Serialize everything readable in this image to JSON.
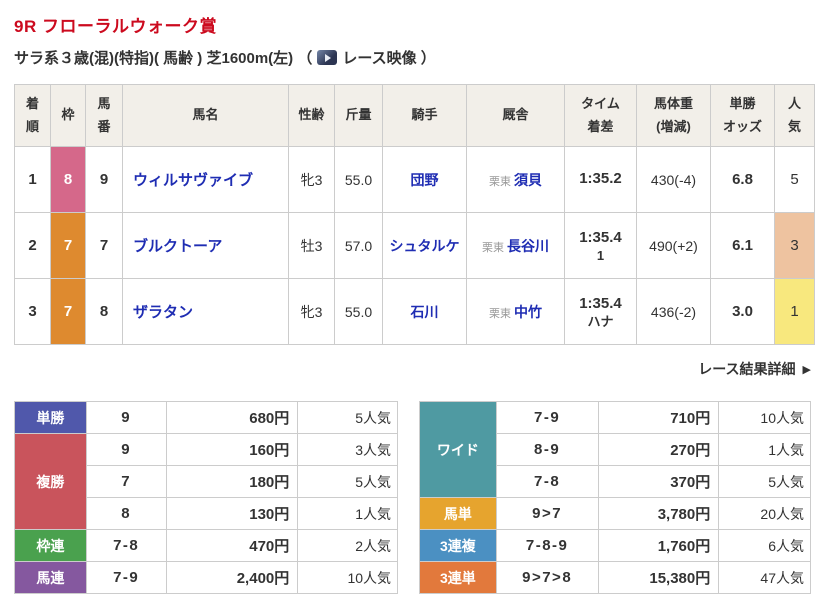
{
  "header": {
    "title": "9R フローラルウォーク賞",
    "title_color": "#cc0a1e",
    "conditions": "サラ系３歳(混)(特指)( 馬齢 ) 芝1600m(左)",
    "video_paren_open": "（",
    "video_label": "レース映像",
    "video_paren_close": "）"
  },
  "results": {
    "headers": [
      "着\n順",
      "枠",
      "馬\n番",
      "馬名",
      "性齢",
      "斤量",
      "騎手",
      "厩舎",
      "タイム\n着差",
      "馬体重\n(増減)",
      "単勝\nオッズ",
      "人\n気"
    ],
    "rows": [
      {
        "rank": "1",
        "frame": "8",
        "frame_color": "#d5688a",
        "num": "9",
        "name": "ウィルサヴァイブ",
        "sex_age": "牝3",
        "weight": "55.0",
        "jockey": "団野",
        "region": "栗東",
        "trainer": "須貝",
        "time": "1:35.2",
        "margin": "",
        "body_weight": "430(-4)",
        "odds": "6.8",
        "popularity": "5",
        "pop_bg": ""
      },
      {
        "rank": "2",
        "frame": "7",
        "frame_color": "#de8a2f",
        "num": "7",
        "name": "ブルクトーア",
        "sex_age": "牡3",
        "weight": "57.0",
        "jockey": "シュタルケ",
        "region": "栗東",
        "trainer": "長谷川",
        "time": "1:35.4",
        "margin": "1",
        "body_weight": "490(+2)",
        "odds": "6.1",
        "popularity": "3",
        "pop_bg": "#eec3a0"
      },
      {
        "rank": "3",
        "frame": "7",
        "frame_color": "#de8a2f",
        "num": "8",
        "name": "ザラタン",
        "sex_age": "牝3",
        "weight": "55.0",
        "jockey": "石川",
        "region": "栗東",
        "trainer": "中竹",
        "time": "1:35.4",
        "margin": "ハナ",
        "body_weight": "436(-2)",
        "odds": "3.0",
        "popularity": "1",
        "pop_bg": "#f8e87e"
      }
    ]
  },
  "details_link": {
    "label": "レース結果詳細",
    "arrow": "▶"
  },
  "payouts": {
    "left": [
      {
        "label": "単勝",
        "color": "#5058ab",
        "rows": [
          {
            "combo": "9",
            "amount": "680円",
            "pop": "5人気"
          }
        ]
      },
      {
        "label": "複勝",
        "color": "#c9545c",
        "rows": [
          {
            "combo": "9",
            "amount": "160円",
            "pop": "3人気"
          },
          {
            "combo": "7",
            "amount": "180円",
            "pop": "5人気"
          },
          {
            "combo": "8",
            "amount": "130円",
            "pop": "1人気"
          }
        ]
      },
      {
        "label": "枠連",
        "color": "#4aa14e",
        "rows": [
          {
            "combo": "7-8",
            "amount": "470円",
            "pop": "2人気"
          }
        ]
      },
      {
        "label": "馬連",
        "color": "#85589f",
        "rows": [
          {
            "combo": "7-9",
            "amount": "2,400円",
            "pop": "10人気"
          }
        ]
      }
    ],
    "right": [
      {
        "label": "ワイド",
        "color": "#4f9aa2",
        "rows": [
          {
            "combo": "7-9",
            "amount": "710円",
            "pop": "10人気"
          },
          {
            "combo": "8-9",
            "amount": "270円",
            "pop": "1人気"
          },
          {
            "combo": "7-8",
            "amount": "370円",
            "pop": "5人気"
          }
        ]
      },
      {
        "label": "馬単",
        "color": "#e6a42e",
        "rows": [
          {
            "combo": "9>7",
            "amount": "3,780円",
            "pop": "20人気"
          }
        ]
      },
      {
        "label": "3連複",
        "color": "#4b90c2",
        "rows": [
          {
            "combo": "7-8-9",
            "amount": "1,760円",
            "pop": "6人気"
          }
        ]
      },
      {
        "label": "3連単",
        "color": "#e2793c",
        "rows": [
          {
            "combo": "9>7>8",
            "amount": "15,380円",
            "pop": "47人気"
          }
        ]
      }
    ]
  }
}
